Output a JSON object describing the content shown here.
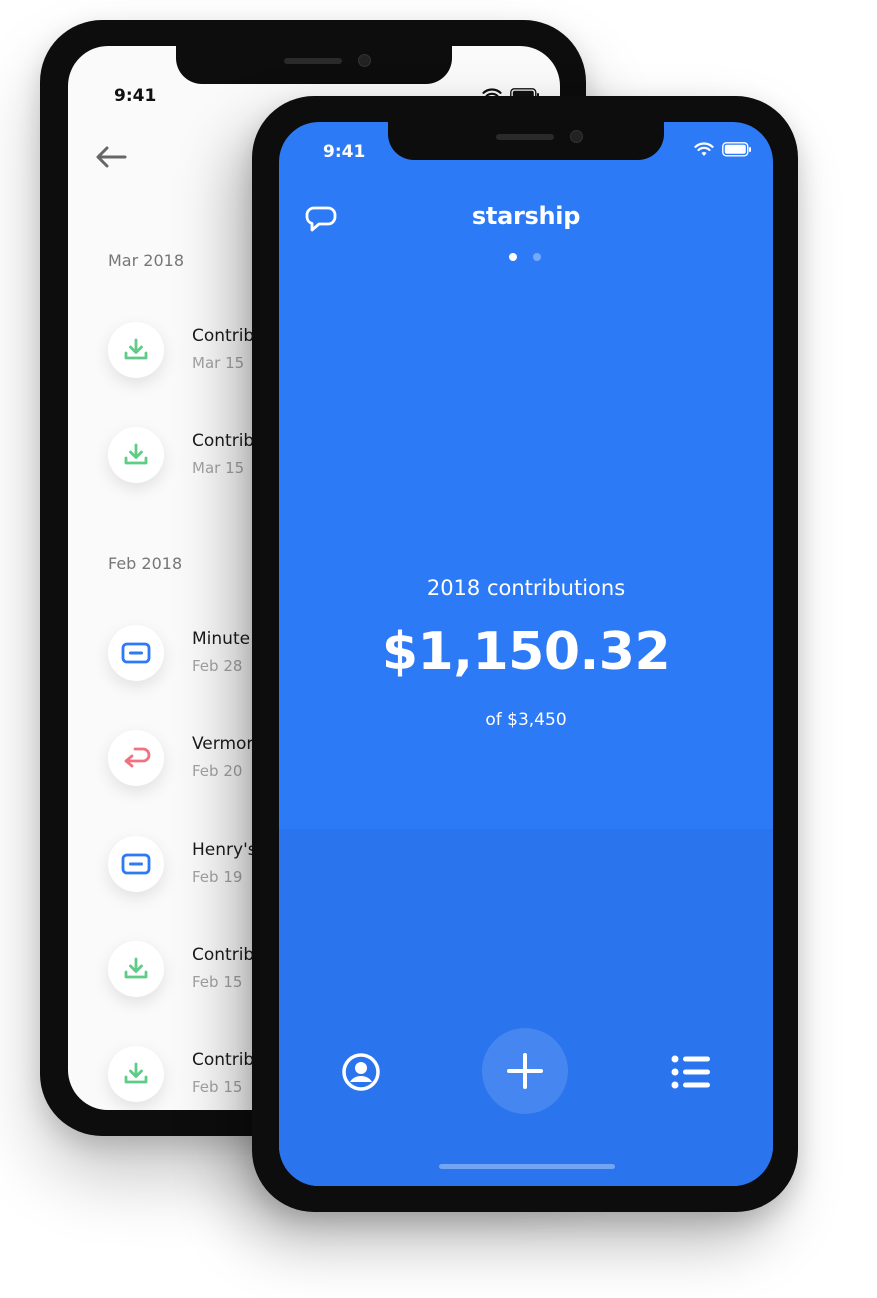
{
  "back_phone": {
    "status": {
      "time": "9:41"
    },
    "icons": {
      "back": "arrow-left-icon"
    },
    "sections": [
      {
        "label": "Mar 2018",
        "items": [
          {
            "title": "Contrib",
            "date": "Mar 15",
            "icon": "download-icon"
          },
          {
            "title": "Contrib",
            "date": "Mar 15",
            "icon": "download-icon"
          }
        ]
      },
      {
        "label": "Feb 2018",
        "items": [
          {
            "title": "Minute",
            "date": "Feb 28",
            "icon": "card-icon"
          },
          {
            "title": "Vermor",
            "date": "Feb 20",
            "icon": "return-arrow-icon"
          },
          {
            "title": "Henry's",
            "date": "Feb 19",
            "icon": "card-icon"
          },
          {
            "title": "Contrib",
            "date": "Feb 15",
            "icon": "download-icon"
          },
          {
            "title": "Contrib",
            "date": "Feb 15",
            "icon": "download-icon"
          }
        ]
      }
    ]
  },
  "front_phone": {
    "status": {
      "time": "9:41"
    },
    "header": {
      "brand": "starship",
      "chat_icon": "chat-bubble-icon"
    },
    "pager": {
      "total": 2,
      "active": 1
    },
    "summary": {
      "label": "2018 contributions",
      "amount": "$1,150.32",
      "goal": "of $3,450"
    },
    "tabbar": {
      "profile_icon": "profile-icon",
      "add_icon": "plus-icon",
      "list_icon": "list-icon"
    }
  },
  "colors": {
    "brand_blue": "#2d7af6",
    "green_icon": "#5fcb86",
    "blue_icon": "#2d7af6",
    "red_icon": "#f0717f"
  }
}
